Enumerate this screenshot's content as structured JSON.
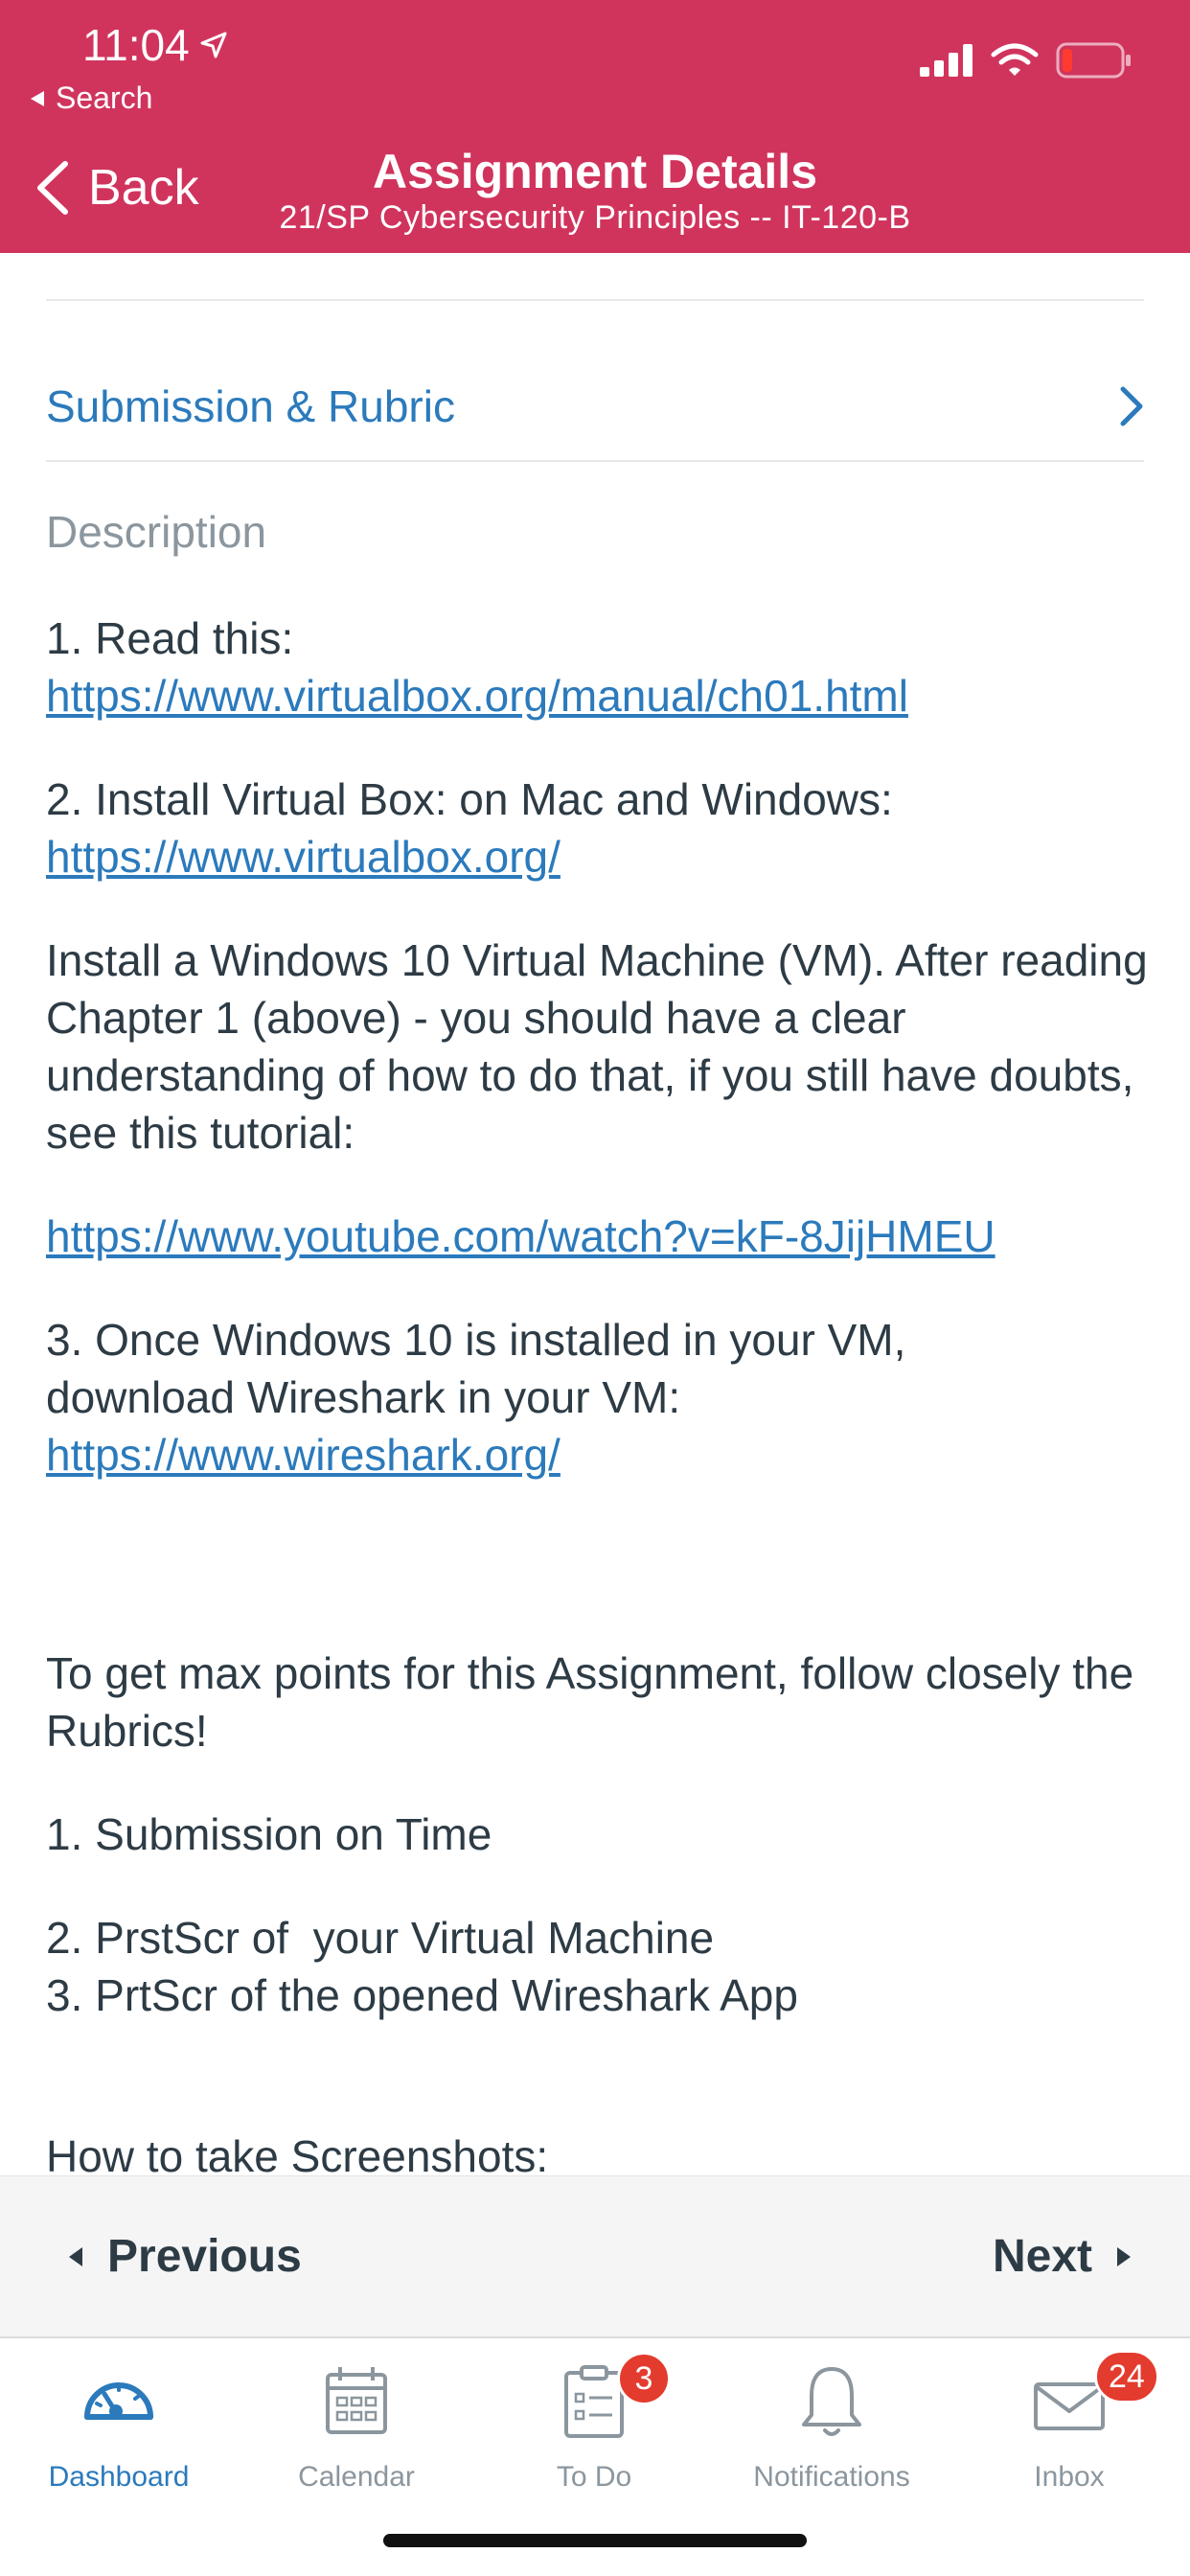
{
  "status_bar": {
    "time": "11:04",
    "back_label": "Search"
  },
  "colors": {
    "header": "#d0345d",
    "link": "#2b7abc",
    "text": "#2d3b45",
    "muted": "#8b969e",
    "badge": "#e33b2e"
  },
  "nav": {
    "back_label": "Back",
    "title": "Assignment Details",
    "subtitle": "21/SP Cybersecurity Principles -- IT-120-B"
  },
  "submission_row": {
    "label": "Submission & Rubric"
  },
  "description": {
    "title": "Description",
    "p1_text": "1. Read this:",
    "p1_link": "https://www.virtualbox.org/manual/ch01.html",
    "p2_text": "2. Install Virtual Box: on Mac and Windows:",
    "p2_link": "https://www.virtualbox.org/",
    "p3_text": "Install a Windows 10 Virtual Machine (VM). After reading Chapter 1 (above) - you should have a clear understanding of how to do that, if you still have doubts, see this tutorial:",
    "p4_link": "https://www.youtube.com/watch?v=kF-8JijHMEU",
    "p5_line1": "3. Once Windows 10 is installed in your VM,",
    "p5_line2": "download Wireshark in your VM:",
    "p5_link": "https://www.wireshark.org/",
    "p6_text": "To get max points for this Assignment, follow closely the Rubrics!",
    "p7_text": "1. Submission on Time",
    "p8_line1": "2. PrstScr of  your Virtual Machine",
    "p8_line2": "3. PrtScr of the opened Wireshark App",
    "p9_text": "How to take Screenshots:"
  },
  "pager": {
    "previous_label": "Previous",
    "next_label": "Next"
  },
  "tabs": [
    {
      "label": "Dashboard",
      "icon": "dashboard-icon"
    },
    {
      "label": "Calendar",
      "icon": "calendar-icon"
    },
    {
      "label": "To Do",
      "icon": "todo-icon",
      "badge": "3"
    },
    {
      "label": "Notifications",
      "icon": "bell-icon"
    },
    {
      "label": "Inbox",
      "icon": "mail-icon",
      "badge": "24"
    }
  ]
}
